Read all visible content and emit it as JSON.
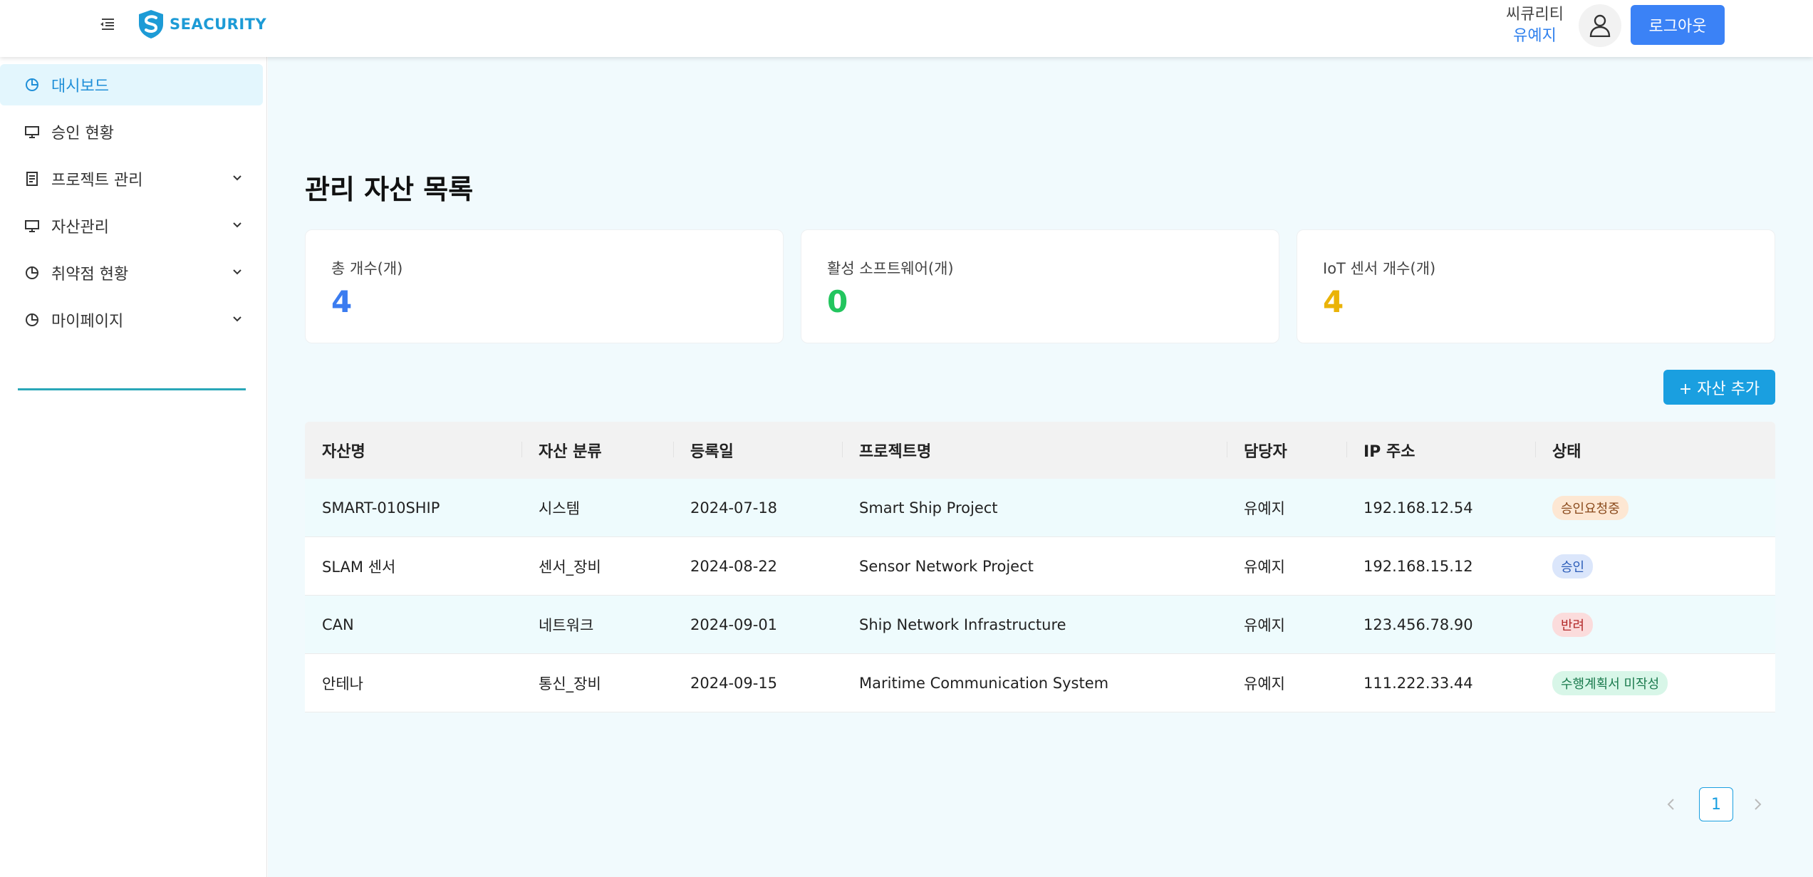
{
  "header": {
    "logo_text": "SEACURITY",
    "user_org": "씨큐리티",
    "user_name": "유예지",
    "logout_label": "로그아웃"
  },
  "sidebar": {
    "items": [
      {
        "label": "대시보드",
        "icon": "pie-chart-icon",
        "active": true,
        "expandable": false
      },
      {
        "label": "승인 현황",
        "icon": "monitor-icon",
        "active": false,
        "expandable": false
      },
      {
        "label": "프로젝트 관리",
        "icon": "document-icon",
        "active": false,
        "expandable": true
      },
      {
        "label": "자산관리",
        "icon": "monitor-icon",
        "active": false,
        "expandable": true
      },
      {
        "label": "취약점 현황",
        "icon": "pie-chart-icon",
        "active": false,
        "expandable": true
      },
      {
        "label": "마이페이지",
        "icon": "pie-chart-icon",
        "active": false,
        "expandable": true
      }
    ]
  },
  "main": {
    "title": "관리 자산 목록",
    "cards": [
      {
        "label": "총 개수(개)",
        "value": "4",
        "color": "#3b7cf0"
      },
      {
        "label": "활성 소프트웨어(개)",
        "value": "0",
        "color": "#22c55e"
      },
      {
        "label": "IoT 센서 개수(개)",
        "value": "4",
        "color": "#eab308"
      }
    ],
    "add_button_label": "+ 자산 추가",
    "table": {
      "headers": [
        "자산명",
        "자산 분류",
        "등록일",
        "프로젝트명",
        "담당자",
        "IP 주소",
        "상태"
      ],
      "rows": [
        {
          "name": "SMART-010SHIP",
          "category": "시스템",
          "date": "2024-07-18",
          "project": "Smart Ship Project",
          "owner": "유예지",
          "ip": "192.168.12.54",
          "status": "승인요청중"
        },
        {
          "name": "SLAM 센서",
          "category": "센서_장비",
          "date": "2024-08-22",
          "project": "Sensor Network Project",
          "owner": "유예지",
          "ip": "192.168.15.12",
          "status": "승인"
        },
        {
          "name": "CAN",
          "category": "네트워크",
          "date": "2024-09-01",
          "project": "Ship Network Infrastructure",
          "owner": "유예지",
          "ip": "123.456.78.90",
          "status": "반려"
        },
        {
          "name": "안테나",
          "category": "통신_장비",
          "date": "2024-09-15",
          "project": "Maritime Communication System",
          "owner": "유예지",
          "ip": "111.222.33.44",
          "status": "수행계획서 미작성"
        }
      ]
    },
    "pagination": {
      "current": "1"
    }
  }
}
